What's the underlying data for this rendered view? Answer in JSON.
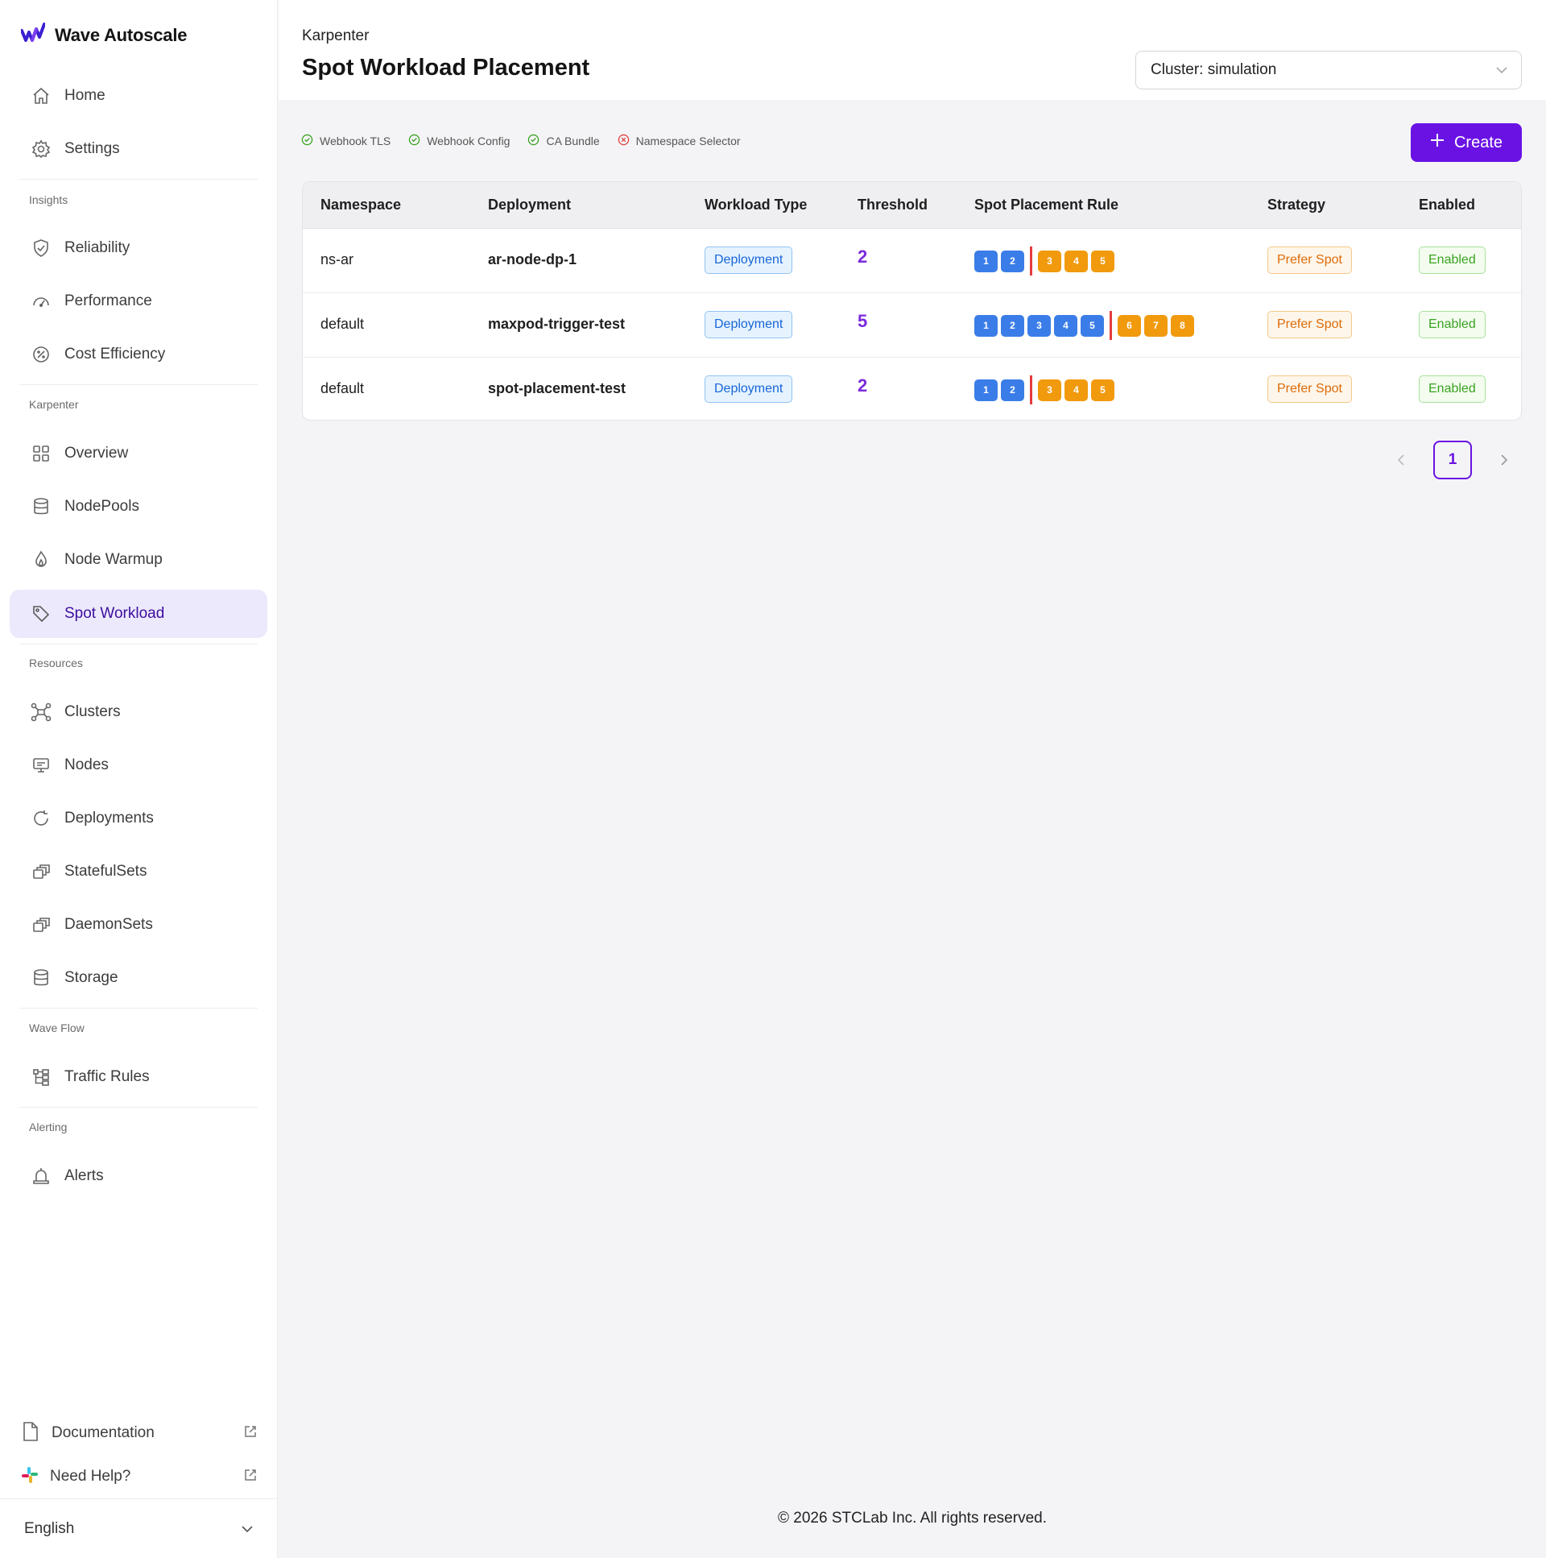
{
  "app": {
    "name": "Wave Autoscale",
    "brand_color": "#6a12e4"
  },
  "sidebar": {
    "top_items": [
      {
        "label": "Home",
        "icon": "home-icon"
      },
      {
        "label": "Settings",
        "icon": "gear-icon"
      }
    ],
    "sections": {
      "insights": "Insights",
      "karpenter": "Karpenter",
      "resources": "Resources",
      "wave_flow": "Wave Flow",
      "alerting": "Alerting"
    },
    "insights_items": [
      {
        "label": "Reliability",
        "icon": "shield-check-icon"
      },
      {
        "label": "Performance",
        "icon": "gauge-icon"
      },
      {
        "label": "Cost Efficiency",
        "icon": "cost-icon"
      }
    ],
    "karpenter_items": [
      {
        "label": "Overview",
        "icon": "grid-icon"
      },
      {
        "label": "NodePools",
        "icon": "database-icon"
      },
      {
        "label": "Node Warmup",
        "icon": "flame-icon"
      },
      {
        "label": "Spot Workload",
        "icon": "tag-icon",
        "active": true
      }
    ],
    "resources_items": [
      {
        "label": "Clusters",
        "icon": "cluster-icon"
      },
      {
        "label": "Nodes",
        "icon": "monitor-icon"
      },
      {
        "label": "Deployments",
        "icon": "refresh-icon"
      },
      {
        "label": "StatefulSets",
        "icon": "stack-icon"
      },
      {
        "label": "DaemonSets",
        "icon": "stack-icon"
      },
      {
        "label": "Storage",
        "icon": "database-icon"
      }
    ],
    "wave_flow_items": [
      {
        "label": "Traffic Rules",
        "icon": "branch-icon"
      }
    ],
    "alerting_items": [
      {
        "label": "Alerts",
        "icon": "bell-icon"
      }
    ],
    "bottom": {
      "documentation": "Documentation",
      "help": "Need Help?",
      "language": "English"
    }
  },
  "header": {
    "breadcrumb": "Karpenter",
    "title": "Spot Workload Placement",
    "cluster_select": "Cluster: simulation"
  },
  "status_checks": [
    {
      "label": "Webhook TLS",
      "status": "ok"
    },
    {
      "label": "Webhook Config",
      "status": "ok"
    },
    {
      "label": "CA Bundle",
      "status": "ok"
    },
    {
      "label": "Namespace Selector",
      "status": "error"
    }
  ],
  "create_button": "Create",
  "table": {
    "columns": [
      "Namespace",
      "Deployment",
      "Workload Type",
      "Threshold",
      "Spot Placement Rule",
      "Strategy",
      "Enabled"
    ],
    "rows": [
      {
        "namespace": "ns-ar",
        "deployment": "ar-node-dp-1",
        "workload_type": "Deployment",
        "threshold": "2",
        "on_demand": [
          "1",
          "2"
        ],
        "spot": [
          "3",
          "4",
          "5"
        ],
        "strategy": "Prefer Spot",
        "enabled": "Enabled"
      },
      {
        "namespace": "default",
        "deployment": "maxpod-trigger-test",
        "workload_type": "Deployment",
        "threshold": "5",
        "on_demand": [
          "1",
          "2",
          "3",
          "4",
          "5"
        ],
        "spot": [
          "6",
          "7",
          "8"
        ],
        "strategy": "Prefer Spot",
        "enabled": "Enabled"
      },
      {
        "namespace": "default",
        "deployment": "spot-placement-test",
        "workload_type": "Deployment",
        "threshold": "2",
        "on_demand": [
          "1",
          "2"
        ],
        "spot": [
          "3",
          "4",
          "5"
        ],
        "strategy": "Prefer Spot",
        "enabled": "Enabled"
      }
    ]
  },
  "pagination": {
    "current_page": "1"
  },
  "footer": {
    "copyright": "© 2026 STCLab Inc. All rights reserved."
  },
  "colors": {
    "on_demand_chip": "#3b7de8",
    "spot_chip": "#f19a0e",
    "separator": "#e53b3b",
    "threshold": "#7c2bdb"
  }
}
